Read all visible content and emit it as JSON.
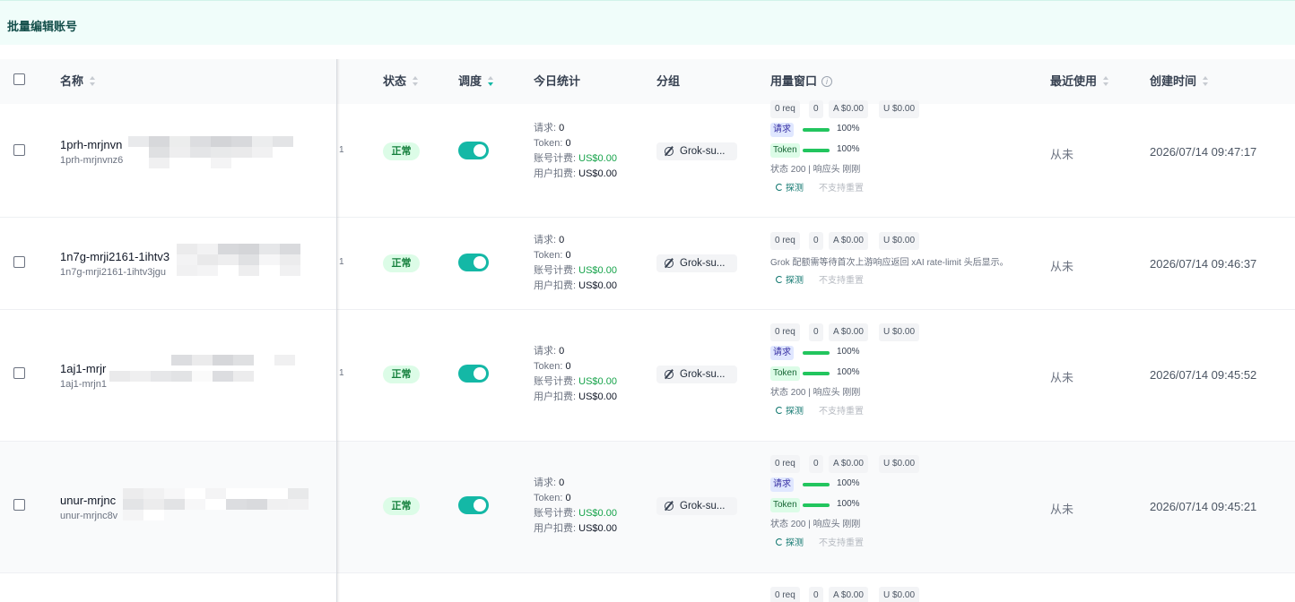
{
  "bulk_edit": {
    "label": "批量编辑账号"
  },
  "columns": {
    "name": "名称",
    "status": "状态",
    "schedule": "调度",
    "today_stats": "今日统计",
    "group": "分组",
    "usage_window": "用量窗口",
    "last_used": "最近使用",
    "created_at": "创建时间"
  },
  "stat_labels": {
    "requests": "请求: ",
    "token": "Token: ",
    "account_billing": "账号计费: ",
    "user_charge": "用户扣费: "
  },
  "usage_labels": {
    "req_tag": "请求",
    "token_tag": "Token",
    "probe": "探测",
    "no_reset": "不支持重置"
  },
  "rows": [
    {
      "name": "1prh-mrjnvn",
      "sub": "1prh-mrjnvnz6",
      "platform_fragment": "1",
      "status": "正常",
      "schedule_enabled": true,
      "requests": "0",
      "tokens": "0",
      "account_billing": "US$0.00",
      "user_charge": "US$0.00",
      "group": "Grok-su...",
      "chips": {
        "req": "0 req",
        "zero": "0",
        "a": "A $0.00",
        "u": "U $0.00"
      },
      "req_pct": "100%",
      "token_pct": "100%",
      "note": "状态 200 | 响应头 刚刚",
      "last_used": "从未",
      "created_at": "2026/07/14 09:47:17"
    },
    {
      "name": "1n7g-mrji2161-1ihtv3",
      "sub": "1n7g-mrji2161-1ihtv3jgu",
      "platform_fragment": "1",
      "status": "正常",
      "schedule_enabled": true,
      "requests": "0",
      "tokens": "0",
      "account_billing": "US$0.00",
      "user_charge": "US$0.00",
      "group": "Grok-su...",
      "chips": {
        "req": "0 req",
        "zero": "0",
        "a": "A $0.00",
        "u": "U $0.00"
      },
      "note": "Grok 配额需等待首次上游响应返回 xAI rate-limit 头后显示。",
      "last_used": "从未",
      "created_at": "2026/07/14 09:46:37"
    },
    {
      "name": "1aj1-mrjr",
      "sub": "1aj1-mrjn1",
      "platform_fragment": "1",
      "status": "正常",
      "schedule_enabled": true,
      "requests": "0",
      "tokens": "0",
      "account_billing": "US$0.00",
      "user_charge": "US$0.00",
      "group": "Grok-su...",
      "chips": {
        "req": "0 req",
        "zero": "0",
        "a": "A $0.00",
        "u": "U $0.00"
      },
      "req_pct": "100%",
      "token_pct": "100%",
      "note": "状态 200 | 响应头 刚刚",
      "last_used": "从未",
      "created_at": "2026/07/14 09:45:52"
    },
    {
      "name": "unur-mrjnc",
      "sub": "unur-mrjnc8v",
      "platform_fragment": "",
      "status": "正常",
      "schedule_enabled": true,
      "requests": "0",
      "tokens": "0",
      "account_billing": "US$0.00",
      "user_charge": "US$0.00",
      "group": "Grok-su...",
      "chips": {
        "req": "0 req",
        "zero": "0",
        "a": "A $0.00",
        "u": "U $0.00"
      },
      "req_pct": "100%",
      "token_pct": "100%",
      "note": "状态 200 | 响应头 刚刚",
      "last_used": "从未",
      "created_at": "2026/07/14 09:45:21"
    },
    {
      "chips": {
        "req": "0 req",
        "zero": "0",
        "a": "A $0.00",
        "u": "U $0.00"
      }
    }
  ],
  "colors": {
    "accent": "#14b8a6",
    "status_ok_bg": "#dcfce7",
    "status_ok_text": "#15803d",
    "money_green": "#16a34a",
    "banner_bg": "#f0fdfa"
  }
}
